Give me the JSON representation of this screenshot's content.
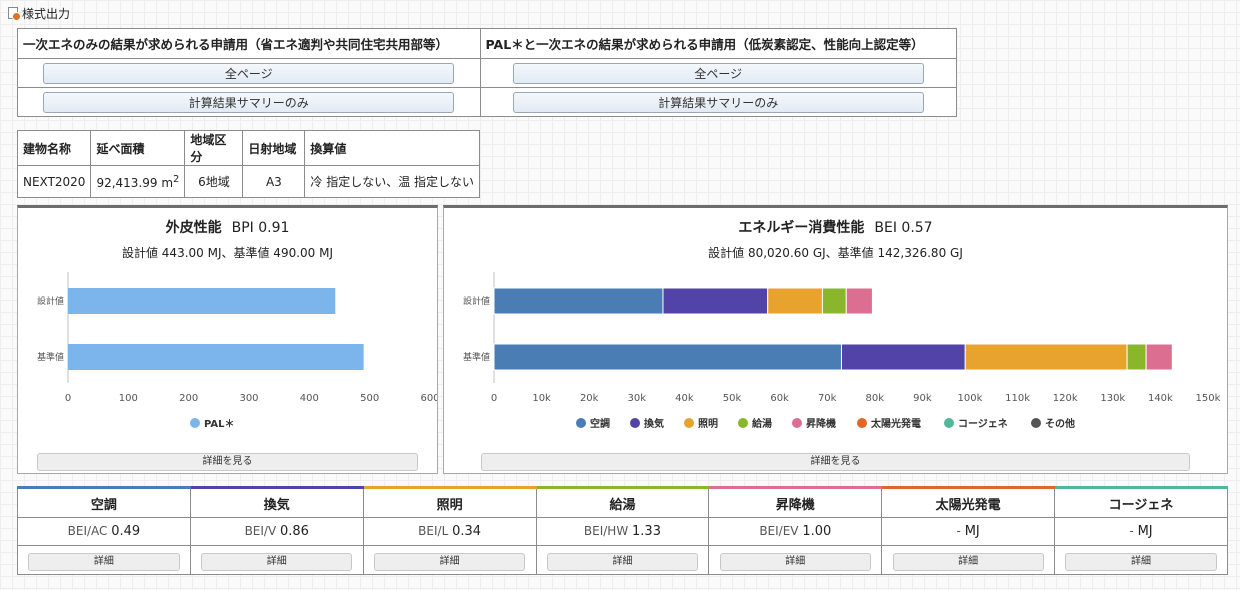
{
  "header": {
    "title": "様式出力"
  },
  "format_table": {
    "col1_header": "一次エネのみの結果が求められる申請用（省エネ適判や共同住宅共用部等）",
    "col2_header": "PAL＊と一次エネの結果が求められる申請用（低炭素認定、性能向上認定等）",
    "all_pages_label": "全ページ",
    "summary_only_label": "計算結果サマリーのみ"
  },
  "building_table": {
    "headers": [
      "建物名称",
      "延べ面積",
      "地域区分",
      "日射地域",
      "換算値"
    ],
    "name": "NEXT2020",
    "area_value": "92,413.99 m",
    "area_sup": "2",
    "region": "6地域",
    "solar_region": "A3",
    "conversion": "冷 指定しない、温 指定しない"
  },
  "bpi_panel": {
    "title": "外皮性能",
    "value": "BPI 0.91",
    "subtitle": "設計値 443.00 MJ、基準値 490.00 MJ",
    "detail_label": "詳細を見る"
  },
  "bei_panel": {
    "title": "エネルギー消費性能",
    "value": "BEI 0.57",
    "subtitle": "設計値 80,020.60 GJ、基準値 142,326.80 GJ",
    "detail_label": "詳細を見る"
  },
  "chart_data": [
    {
      "type": "bar",
      "orientation": "horizontal",
      "categories": [
        "設計値",
        "基準値"
      ],
      "series": [
        {
          "name": "PAL＊",
          "values": [
            443,
            490
          ],
          "color": "#7cb5ec"
        }
      ],
      "xlim": [
        0,
        600
      ],
      "xticks": [
        0,
        100,
        200,
        300,
        400,
        500,
        600
      ],
      "legend": "bottom",
      "grid": false
    },
    {
      "type": "bar",
      "orientation": "horizontal",
      "stacked": true,
      "categories": [
        "設計値",
        "基準値"
      ],
      "series": [
        {
          "name": "空調",
          "values": [
            35500,
            73000
          ],
          "color": "#4a7db3"
        },
        {
          "name": "換気",
          "values": [
            22000,
            26000
          ],
          "color": "#5243a8"
        },
        {
          "name": "照明",
          "values": [
            11500,
            34000
          ],
          "color": "#e8a22e"
        },
        {
          "name": "給湯",
          "values": [
            5000,
            4000
          ],
          "color": "#8ab62c"
        },
        {
          "name": "昇降機",
          "values": [
            5500,
            5500
          ],
          "color": "#dc6e92"
        },
        {
          "name": "太陽光発電",
          "values": [
            0,
            0
          ],
          "color": "#e0662c"
        },
        {
          "name": "コージェネ",
          "values": [
            0,
            0
          ],
          "color": "#4fb89a"
        },
        {
          "name": "その他",
          "values": [
            0,
            0
          ],
          "color": "#555555"
        }
      ],
      "xlim": [
        0,
        150000
      ],
      "xticks": [
        "0",
        "10k",
        "20k",
        "30k",
        "40k",
        "50k",
        "60k",
        "70k",
        "80k",
        "90k",
        "100k",
        "110k",
        "120k",
        "130k",
        "140k",
        "150k"
      ],
      "legend": "bottom",
      "grid": false
    }
  ],
  "categories": [
    {
      "name": "空調",
      "value": "BEI/AC",
      "num": "0.49",
      "color": "#4a7db3",
      "detail": "詳細"
    },
    {
      "name": "換気",
      "value": "BEI/V",
      "num": "0.86",
      "color": "#5243a8",
      "detail": "詳細"
    },
    {
      "name": "照明",
      "value": "BEI/L",
      "num": "0.34",
      "color": "#e8a22e",
      "detail": "詳細"
    },
    {
      "name": "給湯",
      "value": "BEI/HW",
      "num": "1.33",
      "color": "#8ab62c",
      "detail": "詳細"
    },
    {
      "name": "昇降機",
      "value": "BEI/EV",
      "num": "1.00",
      "color": "#dc6e92",
      "detail": "詳細"
    },
    {
      "name": "太陽光発電",
      "value": "-",
      "num": "MJ",
      "color": "#e0662c",
      "detail": "詳細"
    },
    {
      "name": "コージェネ",
      "value": "-",
      "num": "MJ",
      "color": "#4fb89a",
      "detail": "詳細"
    }
  ]
}
